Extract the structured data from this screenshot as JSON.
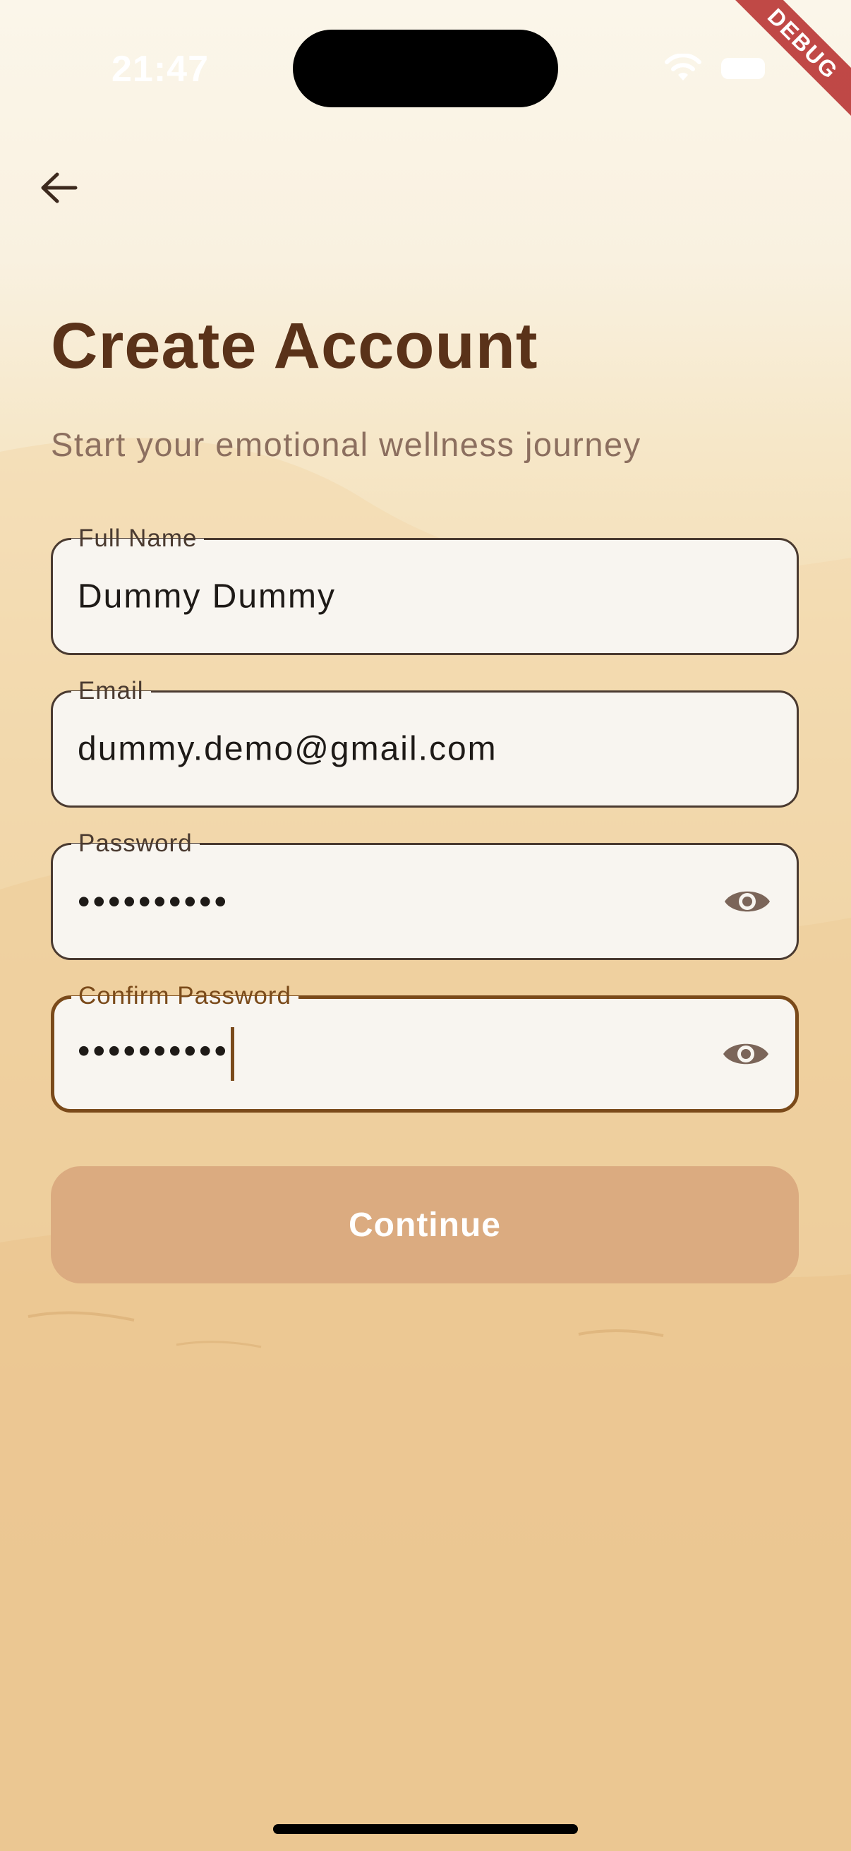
{
  "status_bar": {
    "time": "21:47",
    "debug_label": "DEBUG"
  },
  "header": {
    "back_icon": "arrow-left-icon",
    "title": "Create Account",
    "subtitle": "Start your emotional wellness journey"
  },
  "form": {
    "full_name": {
      "label": "Full Name",
      "value": "Dummy Dummy"
    },
    "email": {
      "label": "Email",
      "value": "dummy.demo@gmail.com"
    },
    "password": {
      "label": "Password",
      "value": "••••••••••",
      "toggle_icon": "eye-icon"
    },
    "confirm_password": {
      "label": "Confirm Password",
      "value": "••••••••••",
      "toggle_icon": "eye-icon",
      "focused": true
    },
    "continue_label": "Continue"
  },
  "colors": {
    "title": "#5a3219",
    "subtitle": "#8c6f5f",
    "focus_border": "#7a4a1a",
    "button_bg": "#dbab80",
    "field_bg": "#f8f5f0"
  }
}
